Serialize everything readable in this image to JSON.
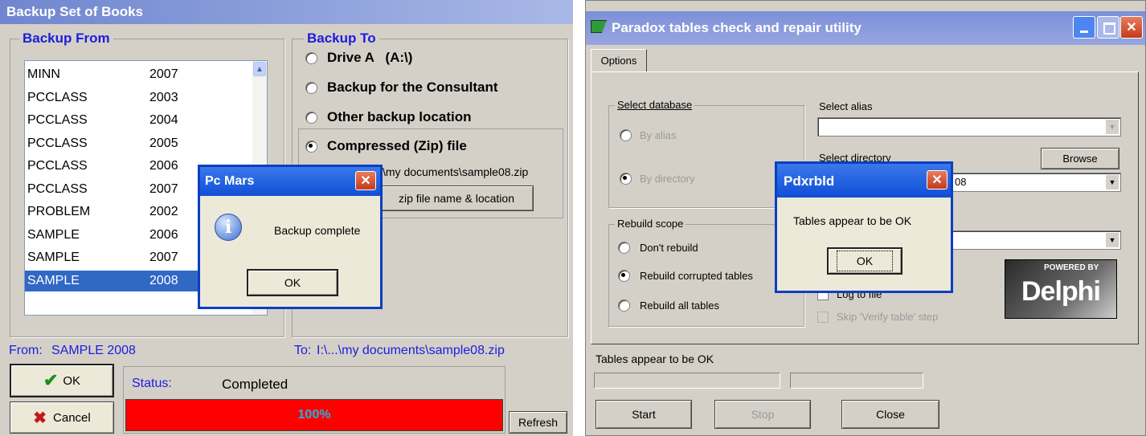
{
  "left": {
    "title": "Backup Set of Books",
    "backup_from": {
      "legend": "Backup From",
      "items": [
        {
          "name": "MINN",
          "year": "2007"
        },
        {
          "name": "PCCLASS",
          "year": "2003"
        },
        {
          "name": "PCCLASS",
          "year": "2004"
        },
        {
          "name": "PCCLASS",
          "year": "2005"
        },
        {
          "name": "PCCLASS",
          "year": "2006"
        },
        {
          "name": "PCCLASS",
          "year": "2007"
        },
        {
          "name": "PROBLEM",
          "year": "2002"
        },
        {
          "name": "SAMPLE",
          "year": "2006"
        },
        {
          "name": "SAMPLE",
          "year": "2007"
        },
        {
          "name": "SAMPLE",
          "year": "2008"
        }
      ],
      "selected_index": 9
    },
    "backup_to": {
      "legend": "Backup To",
      "options": [
        "Drive A   (A:\\)",
        "Backup for the Consultant",
        "Other backup location",
        "Compressed (Zip) file"
      ],
      "selected_index": 3,
      "zip_path": "\\my documents\\sample08.zip",
      "zip_button": "zip file name & location"
    },
    "from_label": "From:",
    "from_value": "SAMPLE 2008",
    "to_label": "To:",
    "to_value": "I:\\...\\my documents\\sample08.zip",
    "ok_label": "OK",
    "cancel_label": "Cancel",
    "status_label": "Status:",
    "status_value": "Completed",
    "progress_text": "100%",
    "progress": 1.0,
    "refresh_label": "Refresh",
    "dialog": {
      "title": "Pc Mars",
      "message": "Backup complete",
      "ok": "OK"
    },
    "colors": {
      "title_bar": "#7c93d8",
      "selection": "#3168c6",
      "progress": "#ff0000",
      "legend": "#1c1ce0"
    }
  },
  "right": {
    "title": "Paradox tables check and repair utility",
    "tab": "Options",
    "select_database": {
      "legend": "Select database",
      "by_alias": "By alias",
      "by_directory": "By directory"
    },
    "select_alias_label": "Select alias",
    "select_directory_label": "Select directory",
    "browse_label": "Browse",
    "directory_value": "08",
    "rebuild_scope": {
      "legend": "Rebuild scope",
      "options": [
        "Don't rebuild",
        "Rebuild corrupted tables",
        "Rebuild all tables"
      ],
      "selected_index": 1
    },
    "log_to_file": "Log to file",
    "skip_verify": "Skip 'Verify table' step",
    "delphi_badge_top": "POWERED BY",
    "delphi_badge_name": "Delphi",
    "status_text": "Tables appear to be OK",
    "start_label": "Start",
    "stop_label": "Stop",
    "close_label": "Close",
    "dialog": {
      "title": "Pdxrbld",
      "message": "Tables appear to be OK",
      "ok": "OK"
    }
  }
}
